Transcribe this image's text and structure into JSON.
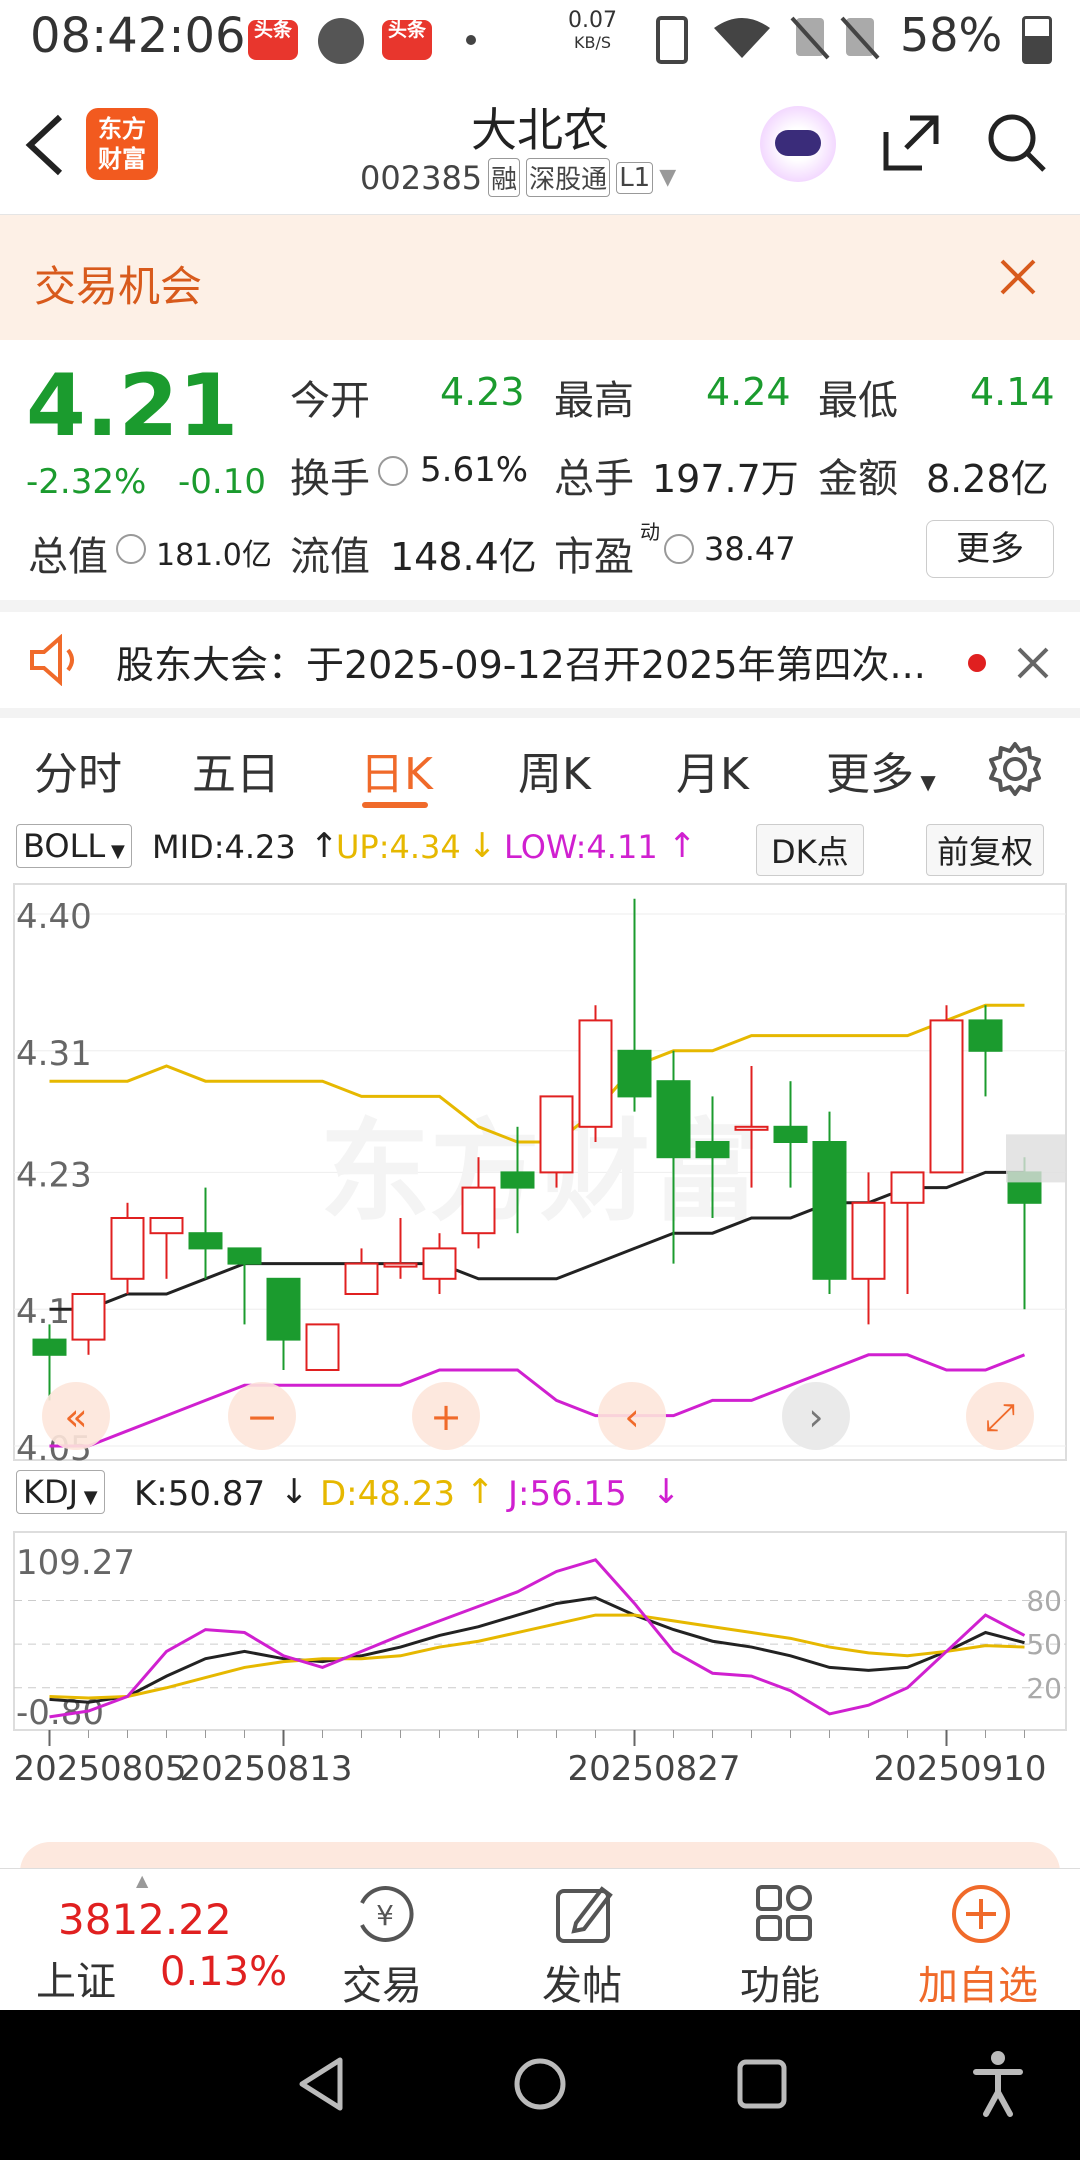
{
  "status_bar": {
    "time": "08:42:06",
    "badge1": "头条",
    "badge2": "头条",
    "net_speed": "0.07",
    "net_unit": "KB/S",
    "battery": "58%"
  },
  "header": {
    "logo": "东方\n财富",
    "stock_name": "大北农",
    "stock_code": "002385",
    "tag1": "融",
    "tag2": "深股通",
    "tag3": "L1"
  },
  "banner": {
    "title": "交易机会"
  },
  "quote": {
    "price": "4.21",
    "change_pct": "-2.32%",
    "change": "-0.10",
    "open_label": "今开",
    "open": "4.23",
    "high_label": "最高",
    "high": "4.24",
    "low_label": "最低",
    "low": "4.14",
    "turnover_label": "换手",
    "turnover": "5.61%",
    "volume_label": "总手",
    "volume": "197.7万",
    "amount_label": "金额",
    "amount": "8.28亿",
    "total_cap_label": "总值",
    "total_cap": "181.0亿",
    "float_cap_label": "流值",
    "float_cap": "148.4亿",
    "pe_label": "市盈",
    "pe_sup": "动",
    "pe": "38.47",
    "more": "更多"
  },
  "notice": {
    "text": "股东大会：于2025-09-12召开2025年第四次..."
  },
  "tabs": [
    "分时",
    "五日",
    "日K",
    "周K",
    "月K",
    "更多"
  ],
  "active_tab": "日K",
  "boll": {
    "select": "BOLL",
    "mid": "MID:4.23",
    "up": "UP:4.34",
    "low": "LOW:4.11",
    "dk": "DK点",
    "adjust": "前复权"
  },
  "kdj": {
    "select": "KDJ",
    "k": "K:50.87",
    "d": "D:48.23",
    "j": "J:56.15"
  },
  "colors": {
    "green": "#1b9b2e",
    "red": "#e02020",
    "yellow": "#e6b800",
    "magenta": "#d020d0",
    "accent": "#f06a2a"
  },
  "chart_data": [
    {
      "type": "candlestick",
      "y_ticks": [
        "4.40",
        "4.31",
        "4.23",
        "4.14",
        "4.05"
      ],
      "x_ticks": [
        "20250805",
        "20250813",
        "20250827",
        "20250910"
      ],
      "candles": [
        {
          "o": 4.12,
          "c": 4.11,
          "h": 4.13,
          "l": 4.08
        },
        {
          "o": 4.12,
          "c": 4.15,
          "h": 4.15,
          "l": 4.11
        },
        {
          "o": 4.16,
          "c": 4.2,
          "h": 4.21,
          "l": 4.15
        },
        {
          "o": 4.19,
          "c": 4.2,
          "h": 4.2,
          "l": 4.16
        },
        {
          "o": 4.19,
          "c": 4.18,
          "h": 4.22,
          "l": 4.16
        },
        {
          "o": 4.18,
          "c": 4.17,
          "h": 4.18,
          "l": 4.13
        },
        {
          "o": 4.16,
          "c": 4.12,
          "h": 4.16,
          "l": 4.1
        },
        {
          "o": 4.1,
          "c": 4.13,
          "h": 4.13,
          "l": 4.1
        },
        {
          "o": 4.15,
          "c": 4.17,
          "h": 4.18,
          "l": 4.15
        },
        {
          "o": 4.17,
          "c": 4.17,
          "h": 4.2,
          "l": 4.16
        },
        {
          "o": 4.16,
          "c": 4.18,
          "h": 4.19,
          "l": 4.15
        },
        {
          "o": 4.19,
          "c": 4.22,
          "h": 4.24,
          "l": 4.18
        },
        {
          "o": 4.23,
          "c": 4.22,
          "h": 4.26,
          "l": 4.19
        },
        {
          "o": 4.23,
          "c": 4.28,
          "h": 4.28,
          "l": 4.22
        },
        {
          "o": 4.26,
          "c": 4.33,
          "h": 4.34,
          "l": 4.25
        },
        {
          "o": 4.31,
          "c": 4.28,
          "h": 4.41,
          "l": 4.27
        },
        {
          "o": 4.29,
          "c": 4.24,
          "h": 4.31,
          "l": 4.17
        },
        {
          "o": 4.25,
          "c": 4.24,
          "h": 4.28,
          "l": 4.2
        },
        {
          "o": 4.26,
          "c": 4.26,
          "h": 4.3,
          "l": 4.22
        },
        {
          "o": 4.26,
          "c": 4.25,
          "h": 4.29,
          "l": 4.22
        },
        {
          "o": 4.25,
          "c": 4.16,
          "h": 4.27,
          "l": 4.15
        },
        {
          "o": 4.16,
          "c": 4.21,
          "h": 4.23,
          "l": 4.13
        },
        {
          "o": 4.21,
          "c": 4.23,
          "h": 4.23,
          "l": 4.15
        },
        {
          "o": 4.23,
          "c": 4.33,
          "h": 4.34,
          "l": 4.23
        },
        {
          "o": 4.33,
          "c": 4.31,
          "h": 4.34,
          "l": 4.28
        },
        {
          "o": 4.23,
          "c": 4.21,
          "h": 4.24,
          "l": 4.14
        }
      ],
      "mid_line": [
        4.14,
        4.14,
        4.15,
        4.15,
        4.16,
        4.17,
        4.17,
        4.17,
        4.17,
        4.17,
        4.17,
        4.16,
        4.16,
        4.16,
        4.17,
        4.18,
        4.19,
        4.19,
        4.2,
        4.2,
        4.21,
        4.21,
        4.22,
        4.22,
        4.23,
        4.23
      ],
      "up_line": [
        4.29,
        4.29,
        4.29,
        4.3,
        4.29,
        4.29,
        4.29,
        4.29,
        4.28,
        4.28,
        4.28,
        4.26,
        4.25,
        4.25,
        4.27,
        4.3,
        4.31,
        4.31,
        4.32,
        4.32,
        4.32,
        4.32,
        4.32,
        4.33,
        4.34,
        4.34
      ],
      "low_line": [
        4.05,
        4.05,
        4.06,
        4.07,
        4.08,
        4.09,
        4.09,
        4.09,
        4.09,
        4.09,
        4.1,
        4.1,
        4.1,
        4.08,
        4.07,
        4.07,
        4.07,
        4.08,
        4.08,
        4.09,
        4.1,
        4.11,
        4.11,
        4.1,
        4.1,
        4.11
      ]
    },
    {
      "type": "line",
      "y_ticks": [
        "109.27",
        "-0.80"
      ],
      "right_ticks": [
        "80",
        "50",
        "20"
      ],
      "series": [
        {
          "name": "K",
          "values": [
            12,
            10,
            14,
            28,
            40,
            45,
            40,
            38,
            42,
            48,
            56,
            62,
            70,
            78,
            82,
            70,
            60,
            52,
            48,
            42,
            34,
            32,
            34,
            45,
            58,
            51
          ]
        },
        {
          "name": "D",
          "values": [
            14,
            13,
            14,
            20,
            27,
            34,
            38,
            40,
            40,
            42,
            48,
            52,
            58,
            64,
            70,
            70,
            66,
            62,
            58,
            54,
            48,
            44,
            42,
            45,
            49,
            48
          ]
        },
        {
          "name": "J",
          "values": [
            0,
            4,
            14,
            45,
            60,
            58,
            42,
            34,
            45,
            56,
            66,
            76,
            86,
            100,
            108,
            78,
            45,
            30,
            28,
            18,
            2,
            8,
            20,
            45,
            70,
            56
          ]
        }
      ]
    }
  ],
  "bottom": {
    "index_value": "3812.22",
    "index_name": "上证",
    "index_pct": "0.13%",
    "trade": "交易",
    "post": "发帖",
    "func": "功能",
    "add": "加自选"
  }
}
